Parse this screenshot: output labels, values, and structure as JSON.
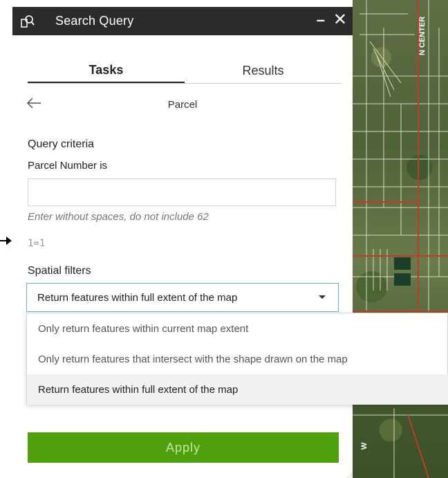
{
  "window": {
    "title": "Search Query",
    "minimize_label": "–",
    "close_label": "✕",
    "app_icon": "search-query-icon"
  },
  "tabs": [
    {
      "label": "Tasks",
      "active": true
    },
    {
      "label": "Results",
      "active": false
    }
  ],
  "task": {
    "back_icon": "back-arrow-icon",
    "title": "Parcel"
  },
  "query": {
    "section_label": "Query criteria",
    "field_label": "Parcel Number is",
    "input_value": "",
    "hint": "Enter without spaces, do not include 62",
    "expression": "1=1"
  },
  "spatial": {
    "section_label": "Spatial filters",
    "selected": "Return features within full extent of the map",
    "options": [
      "Only return features within current map extent",
      "Only return features that intersect with the shape drawn on the map",
      "Return features within full extent of the map"
    ],
    "selected_index": 2
  },
  "apply_label": "Apply",
  "map": {
    "road_label_1": "N CENTER",
    "road_label_2": "W"
  },
  "colors": {
    "titlebar": "#2b2b2b",
    "apply": "#4ea10d",
    "select_border": "#6ea6c9"
  }
}
